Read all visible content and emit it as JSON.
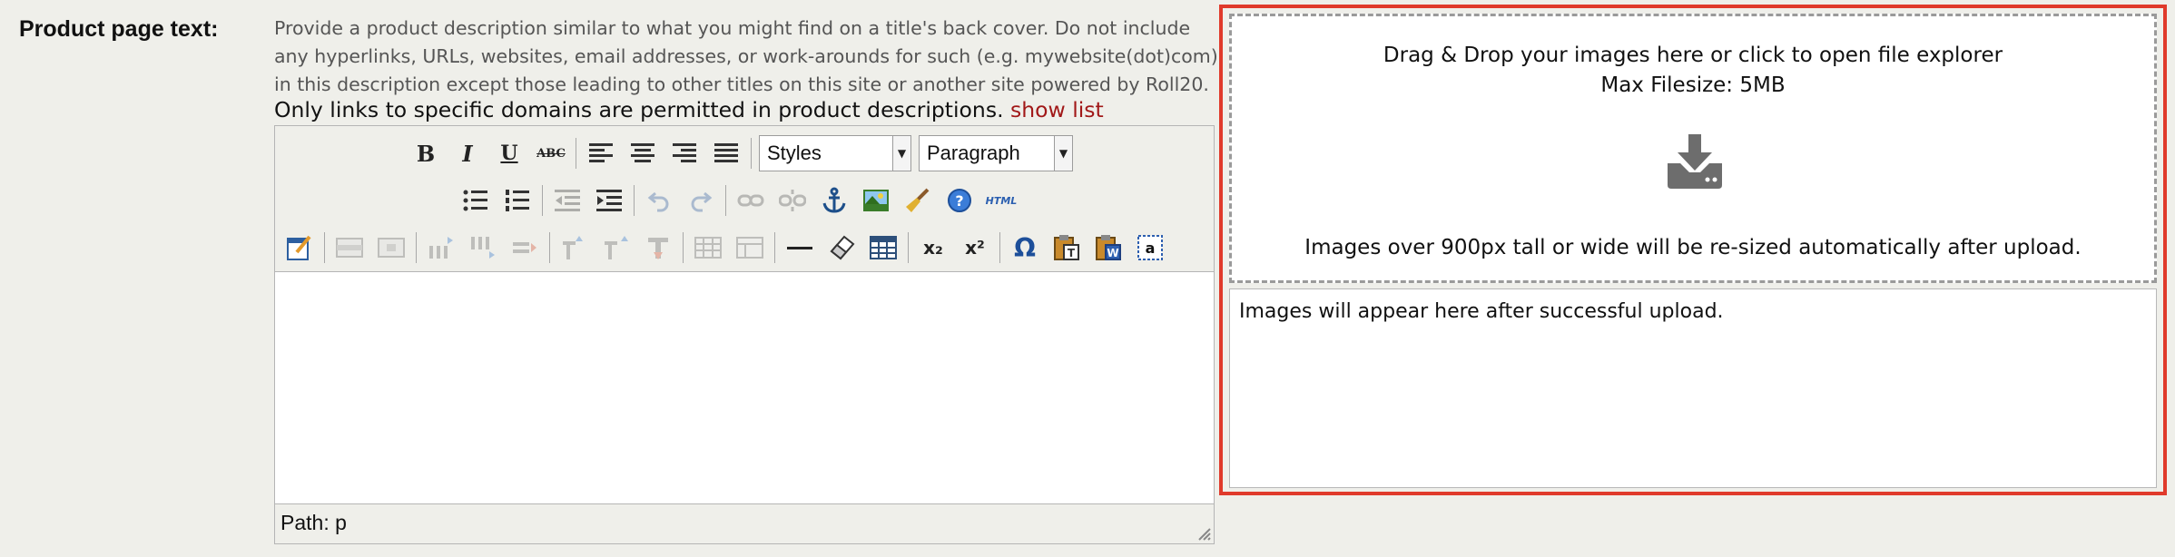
{
  "field": {
    "label": "Product page text:"
  },
  "help": {
    "text": "Provide a product description similar to what you might find on a title's back cover. Do not include any hyperlinks, URLs, websites, email addresses, or work-arounds for such (e.g. mywebsite(dot)com) in this description except those leading to other titles on this site or another site powered by Roll20.",
    "links_notice": "Only links to specific domains are permitted in product descriptions.",
    "show_list": "show list"
  },
  "editor": {
    "toolbar": {
      "bold": "B",
      "italic": "I",
      "underline": "U",
      "strike": "ABC",
      "styles_value": "Styles",
      "format_value": "Paragraph",
      "html_label": "HTML",
      "subscript_label": "x₂",
      "superscript_label": "x²",
      "charmap_label": "Ω"
    },
    "path": "Path: p"
  },
  "upload": {
    "dropzone_line1": "Drag & Drop your images here or click to open file explorer",
    "dropzone_line2": "Max Filesize: 5MB",
    "dropzone_line3": "Images over 900px tall or wide will be re-sized automatically after upload.",
    "uploaded_placeholder": "Images will appear here after successful upload."
  },
  "colors": {
    "highlight_border": "#e03a2b",
    "link": "#a11818",
    "page_bg": "#efefea"
  }
}
